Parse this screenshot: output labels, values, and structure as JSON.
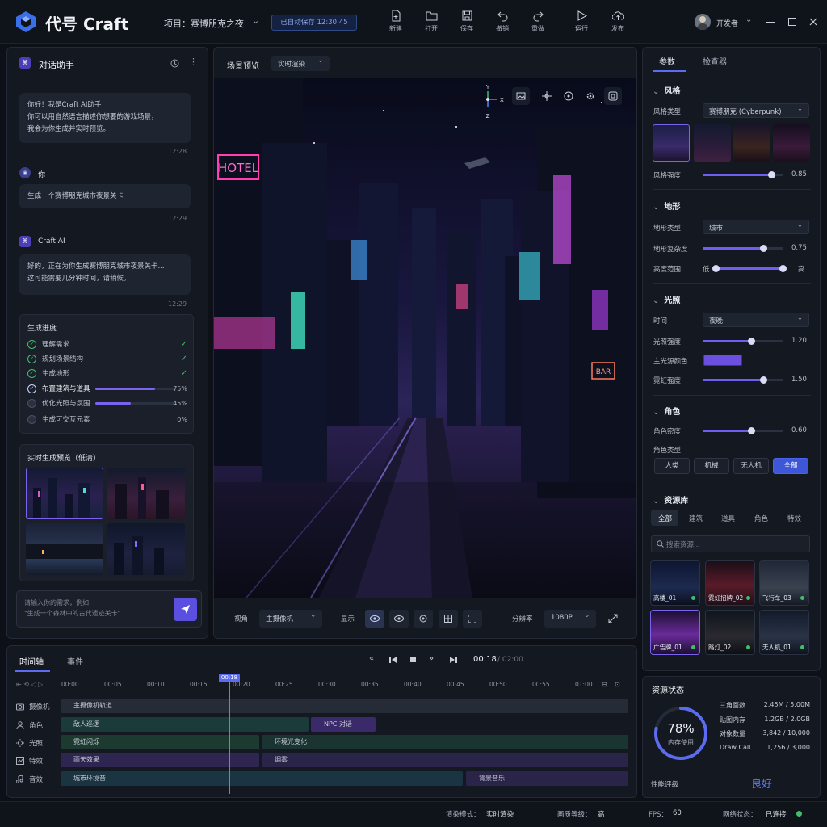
{
  "app": {
    "title": "代号 Craft",
    "project": "项目：赛博朋克之夜",
    "autosave": "已自动保存 12:30:45",
    "user": "开发者"
  },
  "toolbar": [
    {
      "label": "新建",
      "icon": "new-file-icon"
    },
    {
      "label": "打开",
      "icon": "folder-icon"
    },
    {
      "label": "保存",
      "icon": "save-icon"
    },
    {
      "label": "撤销",
      "icon": "undo-icon"
    },
    {
      "label": "重做",
      "icon": "redo-icon"
    },
    {
      "label": "运行",
      "icon": "play-icon"
    },
    {
      "label": "发布",
      "icon": "cloud-upload-icon"
    }
  ],
  "chat": {
    "title": "对话助手",
    "welcome": {
      "text": "你好！我是Craft AI助手\n你可以用自然语言描述你想要的游戏场景，\n我会为你生成并实时预览。",
      "time": "12:28"
    },
    "user": {
      "name": "你",
      "text": "生成一个赛博朋克城市夜景关卡",
      "time": "12:29"
    },
    "ai": {
      "name": "Craft AI",
      "text": "好的，正在为你生成赛博朋克城市夜景关卡...\n这可能需要几分钟时间，请稍候。",
      "time": "12:29"
    },
    "progress": {
      "title": "生成进度",
      "steps": [
        {
          "label": "理解需求",
          "state": "done"
        },
        {
          "label": "规划场景结构",
          "state": "done"
        },
        {
          "label": "生成地形",
          "state": "done"
        },
        {
          "label": "布置建筑与道具",
          "state": "active",
          "percent": "75%",
          "value": 75
        },
        {
          "label": "优化光照与氛围",
          "state": "pending",
          "percent": "45%",
          "value": 45
        },
        {
          "label": "生成可交互元素",
          "state": "pending",
          "percent": "0%",
          "value": 0
        }
      ]
    },
    "preview_title": "实时生成预览（低清）",
    "input_placeholder": "请输入你的需求，例如:\n\"生成一个森林中的古代遗迹关卡\""
  },
  "viewport": {
    "title": "场景预览",
    "mode": "实时渲染",
    "axes": {
      "y": "Y",
      "x": "X",
      "z": "Z"
    },
    "bottom": {
      "view_label": "视角",
      "view_value": "主摄像机",
      "display_label": "显示",
      "res_label": "分辨率",
      "res_value": "1080P"
    },
    "signs": {
      "hotel": "HOTEL",
      "bar": "BAR"
    }
  },
  "inspector": {
    "tabs": [
      "参数",
      "检查器"
    ],
    "style": {
      "title": "风格",
      "type_label": "风格类型",
      "type_value": "赛博朋克 (Cyberpunk)",
      "strength_label": "风格强度",
      "strength": 0.85,
      "strength_text": "0.85"
    },
    "terrain": {
      "title": "地形",
      "type_label": "地形类型",
      "type_value": "城市",
      "complexity_label": "地形复杂度",
      "complexity": 0.75,
      "complexity_text": "0.75",
      "height_label": "高度范围",
      "low": "低",
      "high": "高"
    },
    "light": {
      "title": "光照",
      "time_label": "时间",
      "time_value": "夜晚",
      "intensity_label": "光照强度",
      "intensity": 0.6,
      "intensity_text": "1.20",
      "color_label": "主光源颜色",
      "color": "#6a4fe0",
      "neon_label": "霓虹强度",
      "neon": 0.75,
      "neon_text": "1.50"
    },
    "character": {
      "title": "角色",
      "density_label": "角色密度",
      "density": 0.6,
      "density_text": "0.60",
      "type_label": "角色类型",
      "types": [
        "人类",
        "机械",
        "无人机",
        "全部"
      ]
    },
    "assets": {
      "title": "资源库",
      "tabs": [
        "全部",
        "建筑",
        "道具",
        "角色",
        "特效"
      ],
      "search_placeholder": "搜索资源...",
      "items": [
        "高楼_01",
        "霓虹招牌_02",
        "飞行车_03",
        "广告牌_01",
        "路灯_02",
        "无人机_01"
      ]
    }
  },
  "resources": {
    "title": "资源状态",
    "memory_pct": "78%",
    "memory_value": 78,
    "memory_label": "内存使用",
    "rows": [
      {
        "k": "三角面数",
        "v": "2.45M / 5.00M"
      },
      {
        "k": "贴图内存",
        "v": "1.2GB / 2.0GB"
      },
      {
        "k": "对象数量",
        "v": "3,842 / 10,000"
      },
      {
        "k": "Draw Call",
        "v": "1,256 / 3,000"
      }
    ],
    "rating_label": "性能评级",
    "rating": "良好"
  },
  "timeline": {
    "tabs": [
      "时间轴",
      "事件"
    ],
    "current": "00:18",
    "total": "/ 02:00",
    "playhead": "00:18",
    "ticks": [
      "00:00",
      "00:05",
      "00:10",
      "00:15",
      "00:20",
      "00:25",
      "00:30",
      "00:35",
      "00:40",
      "00:45",
      "00:50",
      "00:55",
      "01:00"
    ],
    "tracks": [
      {
        "name": "摄像机",
        "clips": [
          "主摄像机轨道"
        ]
      },
      {
        "name": "角色",
        "clips": [
          "敌人巡逻",
          "NPC 对话"
        ]
      },
      {
        "name": "光照",
        "clips": [
          "霓虹闪烁",
          "环境光变化"
        ]
      },
      {
        "name": "特效",
        "clips": [
          "雨天效果",
          "烟雾"
        ]
      },
      {
        "name": "音效",
        "clips": [
          "城市环境音",
          "背景音乐"
        ]
      }
    ]
  },
  "status": {
    "render_label": "渲染模式：",
    "render": "实时渲染",
    "quality_label": "画质等级：",
    "quality": "高",
    "fps_label": "FPS：",
    "fps": "60",
    "net_label": "网络状态：",
    "net": "已连接"
  }
}
